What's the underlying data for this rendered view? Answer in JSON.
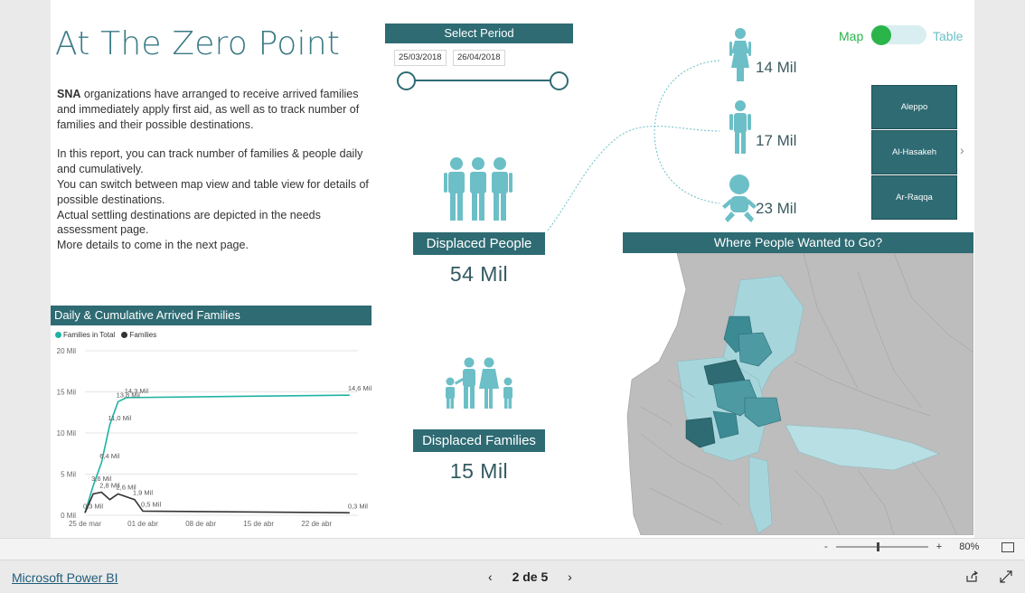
{
  "report": {
    "title": "At The Zero Point",
    "intro_bold": "SNA",
    "intro_p1": " organizations have arranged to receive arrived families and immediately apply first aid, as well as to track number of families and their possible destinations.",
    "intro_lines": [
      "In this report, you can track number of families & people daily and cumulatively.",
      "You can switch between map view and table view for details of possible destinations.",
      "Actual settling destinations are depicted in the needs assessment page.",
      "More details to come in the next page."
    ]
  },
  "period": {
    "header": "Select Period",
    "start_date": "25/03/2018",
    "end_date": "26/04/2018"
  },
  "toggle": {
    "left_label": "Map",
    "right_label": "Table",
    "state": "Map"
  },
  "governorates": [
    "Aleppo",
    "Al-Hasakeh",
    "Ar-Raqqa"
  ],
  "icons": {
    "woman": "woman-icon",
    "man": "man-icon",
    "baby": "baby-icon",
    "people": "people-group-icon",
    "family": "family-icon",
    "chevron": "chevron-right-icon"
  },
  "demographics": {
    "women": "14 Mil",
    "men": "17 Mil",
    "children": "23 Mil"
  },
  "kpis": {
    "people_label": "Displaced People",
    "people_value": "54 Mil",
    "families_label": "Displaced Families",
    "families_value": "15 Mil"
  },
  "map": {
    "header": "Where People Wanted to Go?"
  },
  "chart": {
    "header": "Daily & Cumulative Arrived Families",
    "legend": [
      "Families in Total",
      "Families"
    ]
  },
  "chart_data": {
    "type": "line",
    "title": "Daily & Cumulative Arrived Families",
    "x_ticks": [
      "25 de mar",
      "01 de abr",
      "08 de abr",
      "15 de abr",
      "22 de abr"
    ],
    "y_ticks": [
      "0 Mil",
      "5 Mil",
      "10 Mil",
      "15 Mil",
      "20 Mil"
    ],
    "ylim": [
      0,
      20
    ],
    "grid": true,
    "legend_position": "top-left",
    "series": [
      {
        "name": "Families in Total",
        "color": "#1fb3a3",
        "points": [
          {
            "x": "2018-03-25",
            "y": 0.3,
            "label": "0,3 Mil"
          },
          {
            "x": "2018-03-26",
            "y": 3.6,
            "label": "3,6 Mil"
          },
          {
            "x": "2018-03-27",
            "y": 6.4,
            "label": "6,4 Mil"
          },
          {
            "x": "2018-03-28",
            "y": 11.0,
            "label": "11,0 Mil"
          },
          {
            "x": "2018-03-29",
            "y": 13.8,
            "label": "13,8 Mil"
          },
          {
            "x": "2018-03-30",
            "y": 14.3,
            "label": "14,3 Mil"
          },
          {
            "x": "2018-04-26",
            "y": 14.6,
            "label": "14,6 Mil"
          }
        ]
      },
      {
        "name": "Families",
        "color": "#333333",
        "points": [
          {
            "x": "2018-03-25",
            "y": 0.3,
            "label": ""
          },
          {
            "x": "2018-03-26",
            "y": 2.6,
            "label": ""
          },
          {
            "x": "2018-03-27",
            "y": 2.8,
            "label": "2,8 Mil"
          },
          {
            "x": "2018-03-28",
            "y": 1.9,
            "label": ""
          },
          {
            "x": "2018-03-29",
            "y": 2.6,
            "label": "2,6 Mil"
          },
          {
            "x": "2018-03-31",
            "y": 1.9,
            "label": "1,9 Mil"
          },
          {
            "x": "2018-04-01",
            "y": 0.5,
            "label": "0,5 Mil"
          },
          {
            "x": "2018-04-26",
            "y": 0.3,
            "label": "0,3 Mil"
          }
        ]
      }
    ]
  },
  "footer": {
    "brand_link": "Microsoft Power BI",
    "page_indicator": "2 de 5",
    "zoom": "80%",
    "zoom_minus": "-",
    "zoom_plus": "+"
  }
}
